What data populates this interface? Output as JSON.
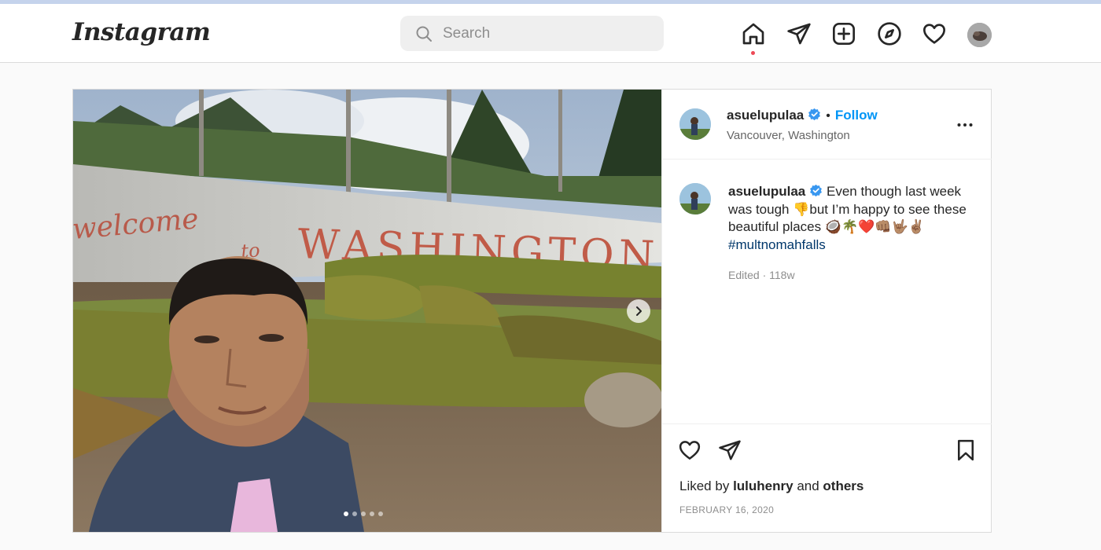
{
  "nav": {
    "logo": "Instagram",
    "search_placeholder": "Search",
    "icons": [
      "home-icon",
      "direct-icon",
      "new-post-icon",
      "explore-icon",
      "activity-icon",
      "profile-avatar"
    ]
  },
  "post": {
    "username": "asuelupulaa",
    "verified": true,
    "separator": "•",
    "follow_label": "Follow",
    "location": "Vancouver, Washington",
    "photo_text": {
      "sign_line1": "welcome",
      "sign_line2": "to",
      "sign_line3": "WASHINGTON"
    },
    "carousel_count": 5,
    "carousel_active": 1,
    "caption": {
      "username": "asuelupulaa",
      "text": "Even though last week was tough 👎but I’m happy to see these beautiful places 🥥🌴❤️👊🏽🤟🏽✌🏽",
      "hashtag": "#multnomahfalls"
    },
    "meta": "Edited · 118w",
    "likes": {
      "prefix": "Liked by",
      "user": "luluhenry",
      "conj": "and",
      "others": "others"
    },
    "date": "FEBRUARY 16, 2020"
  },
  "colors": {
    "accent": "#0095f6",
    "verified": "#3897f0",
    "notification_dot": "#ed4956",
    "hashtag": "#00376b"
  }
}
